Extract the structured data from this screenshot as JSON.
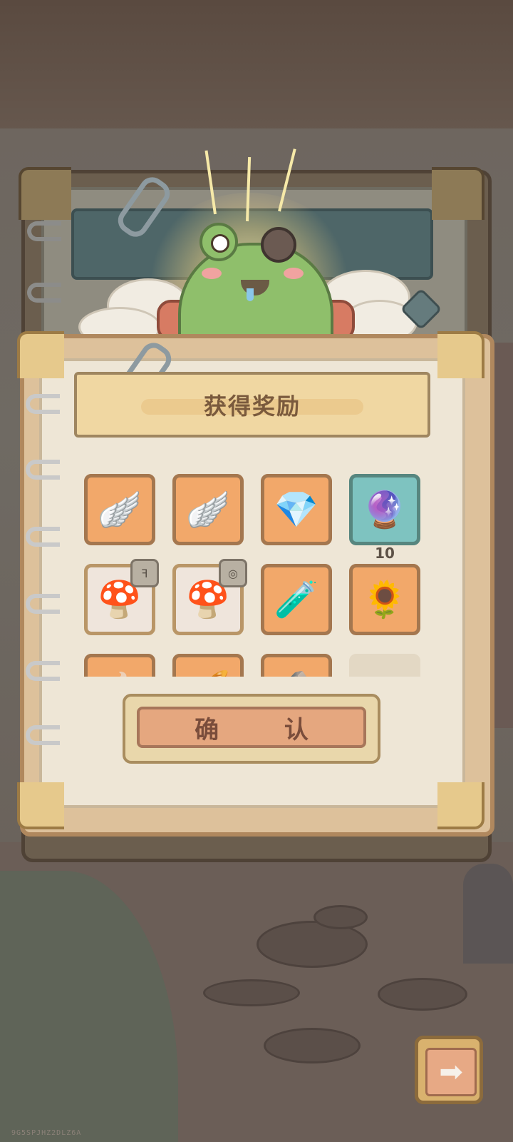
{
  "dialog": {
    "title": "获得奖励",
    "confirm_label": "确 认"
  },
  "rewards": [
    {
      "name": "rainbow-wings",
      "icon": "🪽",
      "bg": "orange"
    },
    {
      "name": "golden-wings",
      "icon": "🪽",
      "bg": "orange"
    },
    {
      "name": "crystal",
      "icon": "💎",
      "bg": "orange"
    },
    {
      "name": "frost-orb",
      "icon": "🔮",
      "bg": "teal",
      "count": "10"
    },
    {
      "name": "blue-mushroom",
      "icon": "🍄",
      "bg": "white",
      "badge": "ꟻ"
    },
    {
      "name": "green-mushroom",
      "icon": "🍄",
      "bg": "white",
      "badge": "◎"
    },
    {
      "name": "potion-vial",
      "icon": "🧪",
      "bg": "orange"
    },
    {
      "name": "seed-bag",
      "icon": "🌻",
      "bg": "orange"
    },
    {
      "name": "partial-item-1",
      "icon": "🍲",
      "bg": "orange"
    },
    {
      "name": "partial-item-2",
      "icon": "🥖",
      "bg": "orange"
    },
    {
      "name": "partial-item-3",
      "icon": "🪨",
      "bg": "orange"
    },
    {
      "name": "empty-slot",
      "icon": "",
      "bg": "empty"
    }
  ],
  "watermark": "9G5SPJHZ2DLZ6A",
  "next_icon": "arrow-right-icon",
  "colors": {
    "slot_orange": "#f2a86a",
    "slot_teal": "#7ec3c0",
    "slot_white": "#efe5dc",
    "button_accent": "#e5a77f"
  }
}
